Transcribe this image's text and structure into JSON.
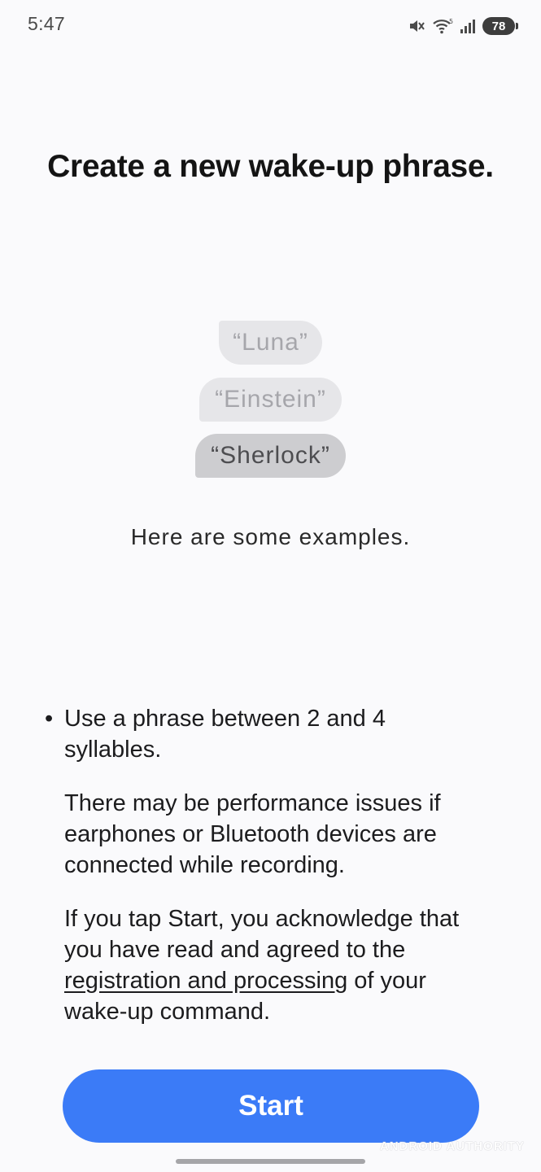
{
  "status_bar": {
    "time": "5:47",
    "battery": "78",
    "icons": [
      "mute-icon",
      "wifi-icon",
      "signal-icon"
    ]
  },
  "title": "Create a new wake-up phrase.",
  "examples": {
    "chips": [
      "“Luna”",
      "“Einstein”",
      "“Sherlock”"
    ],
    "caption": "Here are some examples."
  },
  "info": {
    "bullet": "Use a phrase between 2 and 4 syllables.",
    "performance_note": "There may be performance issues if earphones or Bluetooth devices are connected while recording.",
    "consent_before": "If you tap Start, you acknowledge that you have read and agreed to the ",
    "consent_link": "registration and processing",
    "consent_after": " of your wake-up command."
  },
  "start_button": "Start",
  "watermark": "ANDROID AUTHORITY",
  "colors": {
    "accent": "#3b7bf7",
    "background": "#fafafc"
  }
}
